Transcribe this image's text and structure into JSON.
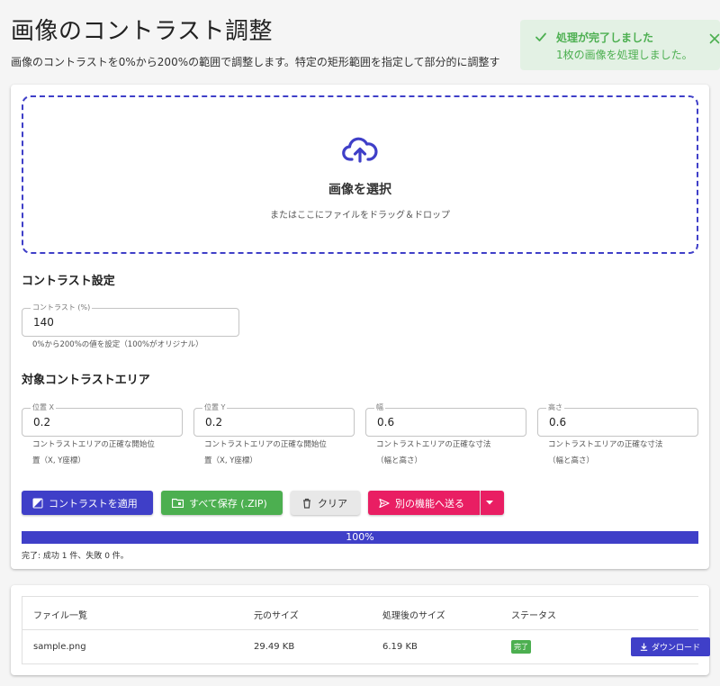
{
  "header": {
    "title": "画像のコントラスト調整",
    "description": "画像のコントラストを0%から200%の範囲で調整します。特定の矩形範囲を指定して部分的に調整す"
  },
  "toast": {
    "title": "処理が完了しました",
    "message": "1枚の画像を処理しました。",
    "color": "#4caf50"
  },
  "dropzone": {
    "title": "画像を選択",
    "subtitle": "またはここにファイルをドラッグ＆ドロップ",
    "icon": "cloud-upload-icon"
  },
  "contrast_settings": {
    "section_title": "コントラスト設定",
    "field_label": "コントラスト (%)",
    "value": "140",
    "helper": "0%から200%の値を設定（100%がオリジナル）"
  },
  "area_settings": {
    "section_title": "対象コントラストエリア",
    "fields": [
      {
        "label": "位置 X",
        "value": "0.2",
        "helper1": "コントラストエリアの正確な開始位",
        "helper2": "置（X, Y座標）"
      },
      {
        "label": "位置 Y",
        "value": "0.2",
        "helper1": "コントラストエリアの正確な開始位",
        "helper2": "置（X, Y座標）"
      },
      {
        "label": "幅",
        "value": "0.6",
        "helper1": "コントラストエリアの正確な寸法",
        "helper2": "（幅と高さ）"
      },
      {
        "label": "高さ",
        "value": "0.6",
        "helper1": "コントラストエリアの正確な寸法",
        "helper2": "（幅と高さ）"
      }
    ]
  },
  "actions": {
    "apply": "コントラストを適用",
    "save_all": "すべて保存 (.ZIP)",
    "clear": "クリア",
    "send": "別の機能へ送る"
  },
  "progress": {
    "value": 1.0,
    "label": "100%",
    "status": "完了: 成功 1 件、失敗 0 件。"
  },
  "file_table": {
    "headers": [
      "ファイル一覧",
      "元のサイズ",
      "処理後のサイズ",
      "ステータス"
    ],
    "rows": [
      {
        "name": "sample.png",
        "original_size": "29.49 KB",
        "processed_size": "6.19 KB",
        "status": "完了",
        "action": "ダウンロード"
      }
    ]
  },
  "colors": {
    "primary": "#3f3fc8",
    "success": "#4caf50",
    "accent": "#e91e63"
  }
}
